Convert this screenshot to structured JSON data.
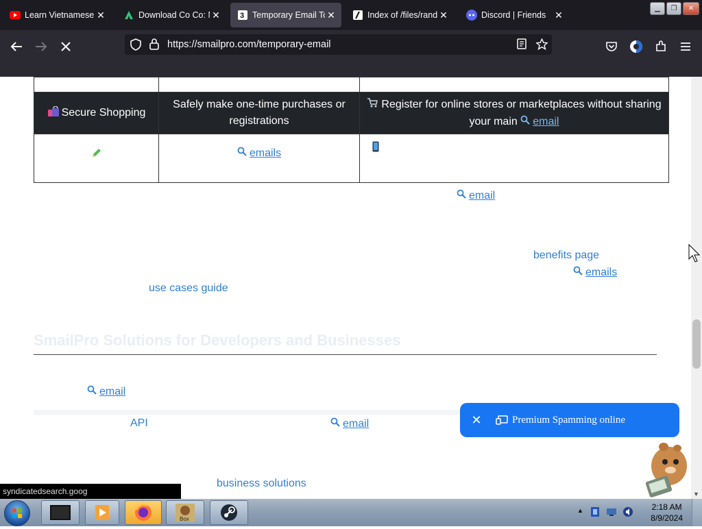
{
  "browser": {
    "tabs": [
      {
        "title": "Learn Vietnamese th",
        "icon": "youtube-icon",
        "active": false
      },
      {
        "title": "Download Co Co: M",
        "icon": "app-store-icon",
        "active": false
      },
      {
        "title": "Temporary Email To",
        "icon": "smailpro-icon",
        "active": true
      },
      {
        "title": "Index of /files/rando",
        "icon": "file-index-icon",
        "active": false
      },
      {
        "title": "Discord | Friends",
        "icon": "discord-icon",
        "active": false
      }
    ],
    "tab_close_glyph": "✕",
    "address_url": "https://smailpro.com/temporary-email"
  },
  "table": {
    "row_secure_shopping": {
      "label": "Secure Shopping",
      "description": "Safely make one-time purchases or registrations",
      "benefit_prefix": "Register for online stores or marketplaces without sharing your main",
      "benefit_link": "email"
    },
    "row_next": {
      "col2_link": "emails"
    }
  },
  "content": {
    "para1_link": "email",
    "para2_link_benefits": "benefits page",
    "para2_link_emails": "emails",
    "para2_link_use_cases": "use cases guide",
    "heading_partial": "SmailPro Solutions for Developers and Businesses",
    "para3_link": "email",
    "para4_link_api": "API",
    "para4_link_email": "email",
    "para5_link_business": "business solutions"
  },
  "toast": {
    "label": "Premium Spamming online",
    "close_glyph": "✕"
  },
  "status_url": "syndicatedsearch.goog",
  "taskbar": {
    "time": "2:18 AM",
    "date": "8/9/2024"
  },
  "colors": {
    "link": "#2f7fd3",
    "table_dark_row": "#212529",
    "toast_bg": "#1976f2"
  }
}
